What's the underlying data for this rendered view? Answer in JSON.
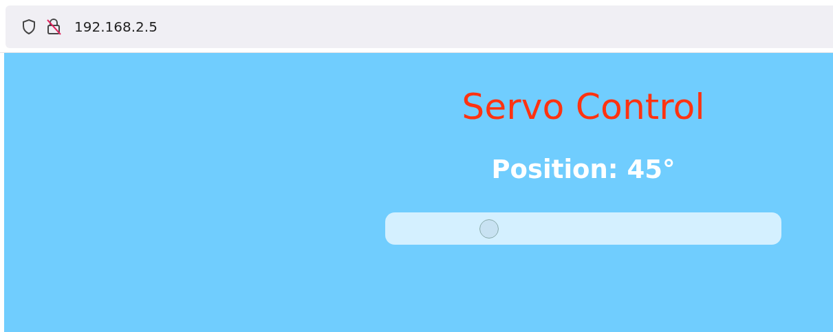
{
  "address_bar": {
    "url": "192.168.2.5"
  },
  "page": {
    "title": "Servo Control",
    "position_label": "Position: 45°",
    "slider": {
      "level": 0.25
    }
  }
}
